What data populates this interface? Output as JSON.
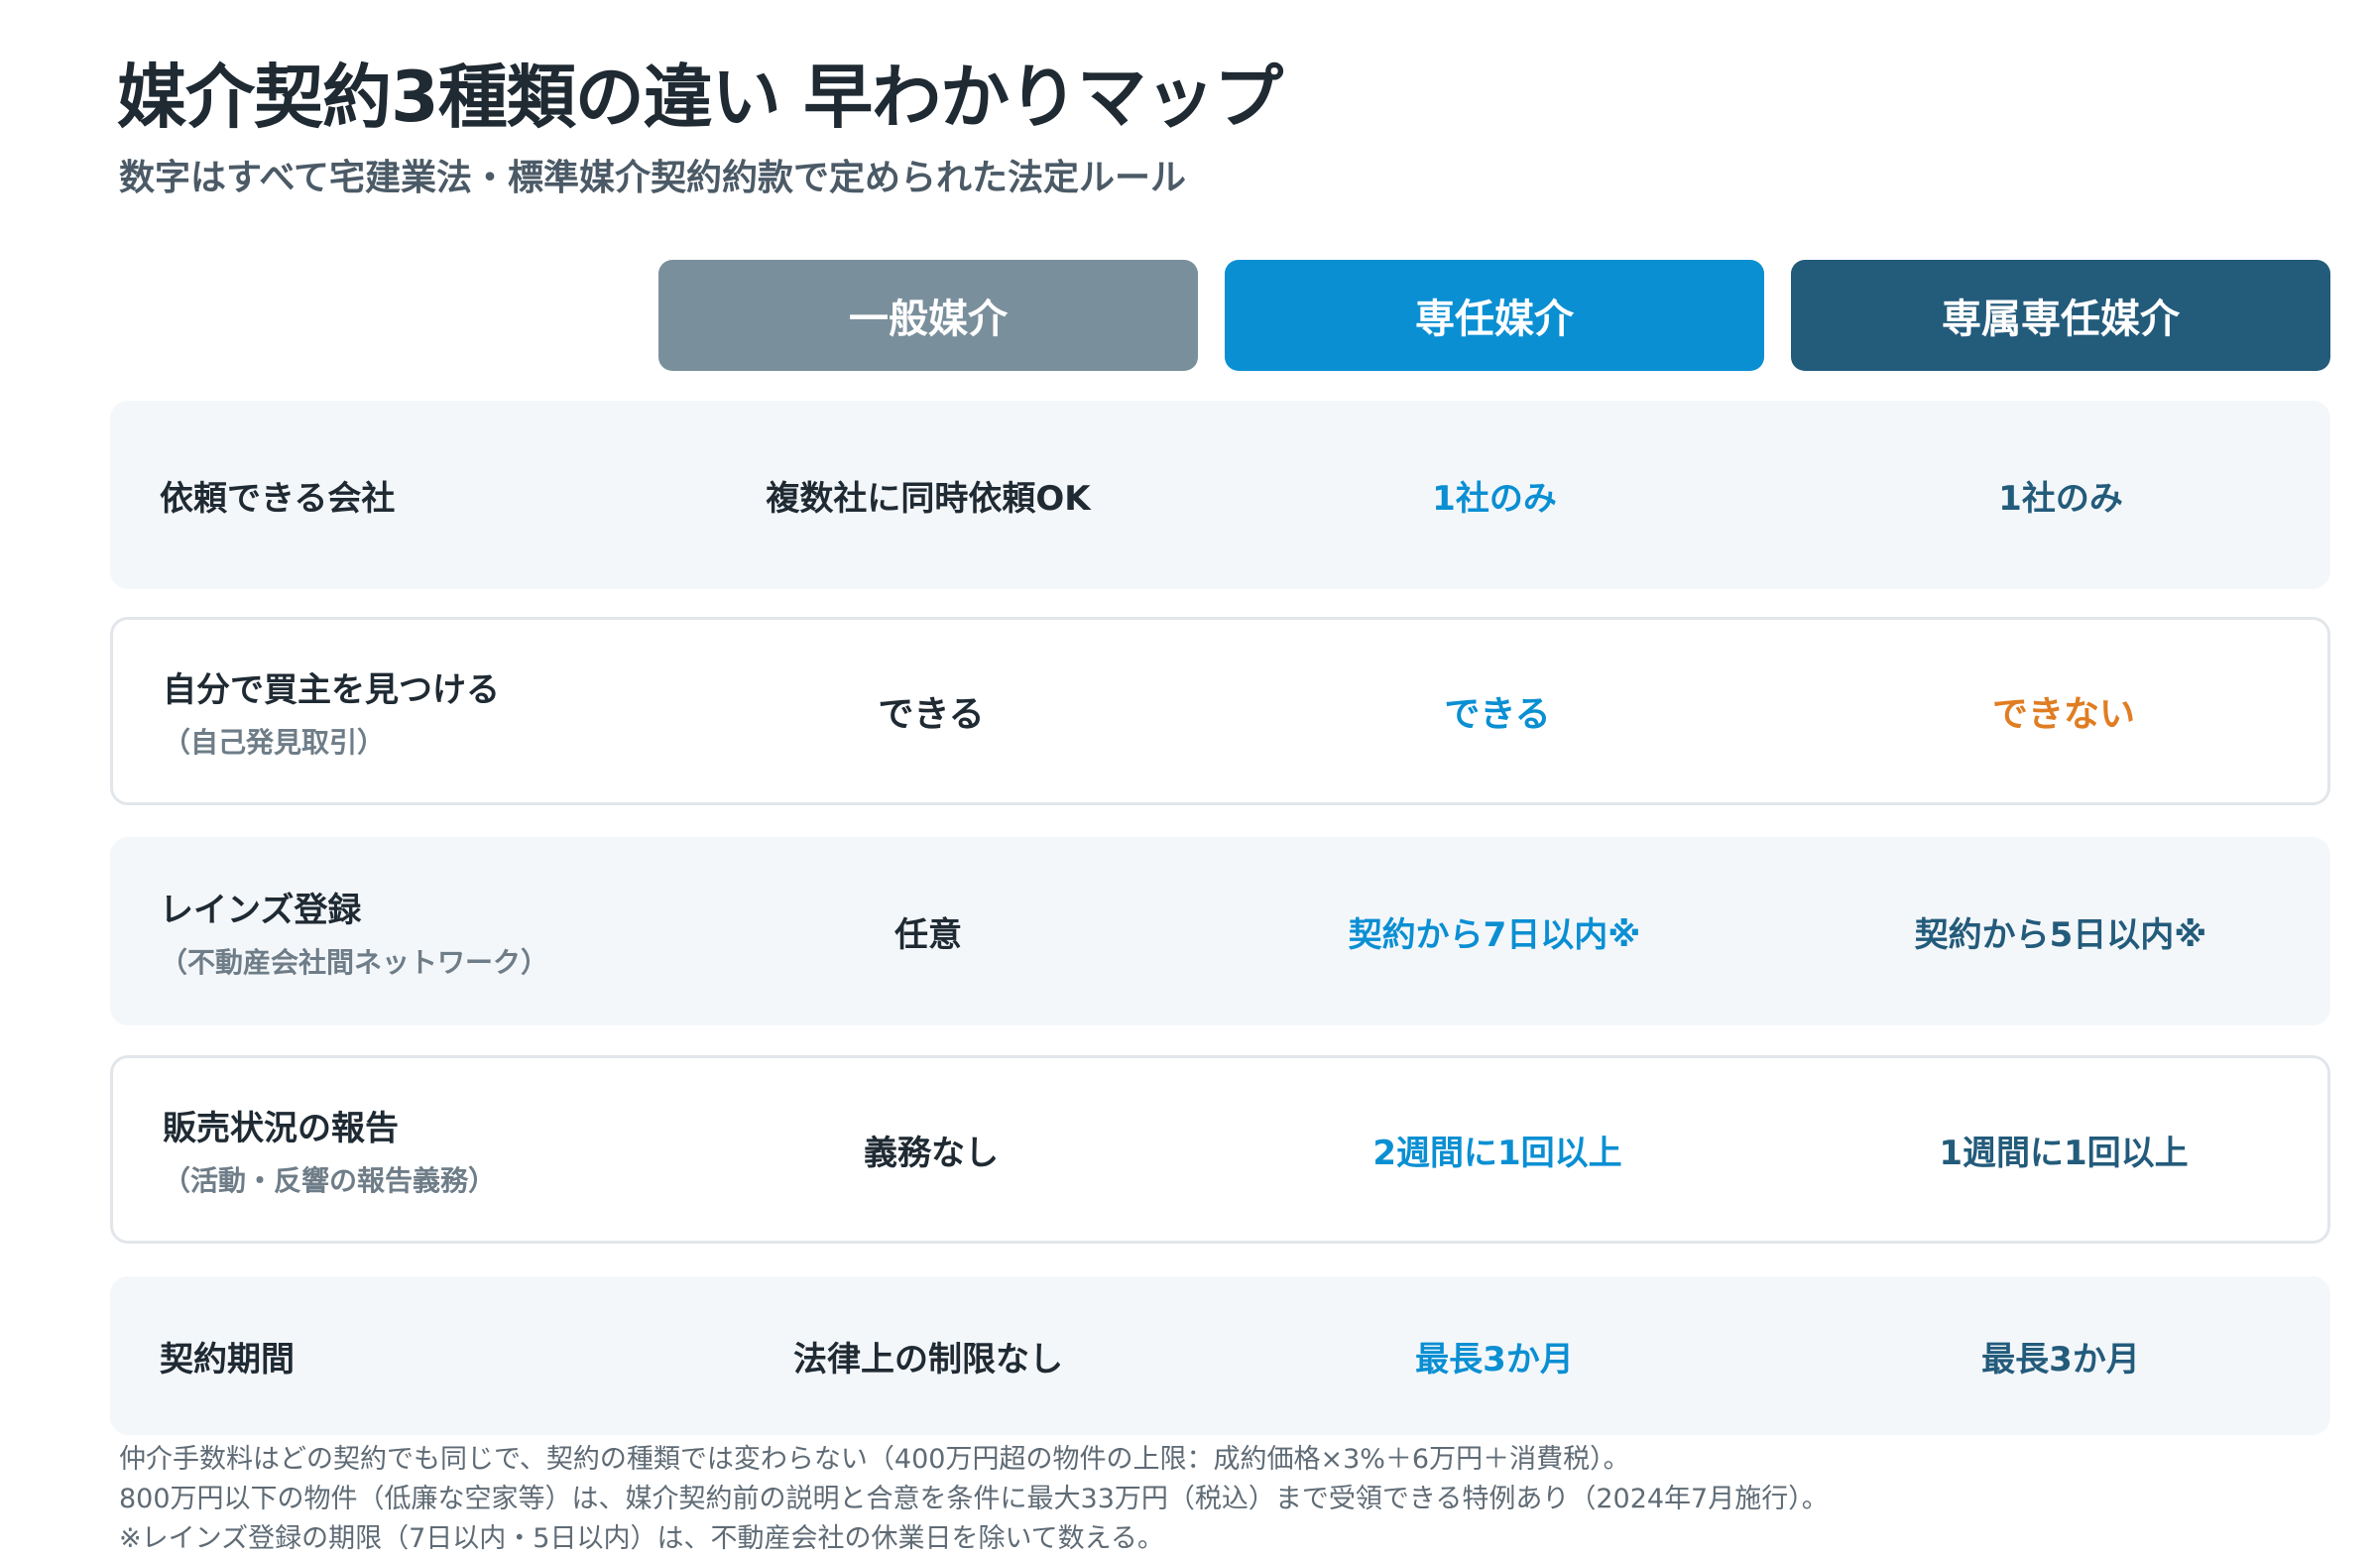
{
  "title": "媒介契約3種類の違い 早わかりマップ",
  "subtitle": "数字はすべて宅建業法・標準媒介契約約款で定められた法定ルール",
  "colors": {
    "general": "#7a8f9c",
    "exclusive": "#0a8fd3",
    "exclusive_dedicated": "#235b7b",
    "warning": "#e07d22",
    "text": "#1f2a33"
  },
  "columns": [
    {
      "label": "一般媒介"
    },
    {
      "label": "専任媒介"
    },
    {
      "label": "専属専任媒介"
    }
  ],
  "rows": [
    {
      "label": "依頼できる会社",
      "sub": "",
      "values": [
        "複数社に同時依頼OK",
        "1社のみ",
        "1社のみ"
      ]
    },
    {
      "label": "自分で買主を見つける",
      "sub": "（自己発見取引）",
      "values": [
        "できる",
        "できる",
        "できない"
      ]
    },
    {
      "label": "レインズ登録",
      "sub": "（不動産会社間ネットワーク）",
      "values": [
        "任意",
        "契約から7日以内※",
        "契約から5日以内※"
      ]
    },
    {
      "label": "販売状況の報告",
      "sub": "（活動・反響の報告義務）",
      "values": [
        "義務なし",
        "2週間に1回以上",
        "1週間に1回以上"
      ]
    },
    {
      "label": "契約期間",
      "sub": "",
      "values": [
        "法律上の制限なし",
        "最長3か月",
        "最長3か月"
      ]
    }
  ],
  "notes": [
    "仲介手数料はどの契約でも同じで、契約の種類では変わらない（400万円超の物件の上限：成約価格×3%＋6万円＋消費税）。",
    "800万円以下の物件（低廉な空家等）は、媒介契約前の説明と合意を条件に最大33万円（税込）まで受領できる特例あり（2024年7月施行）。",
    "※レインズ登録の期限（7日以内・5日以内）は、不動産会社の休業日を除いて数える。"
  ]
}
